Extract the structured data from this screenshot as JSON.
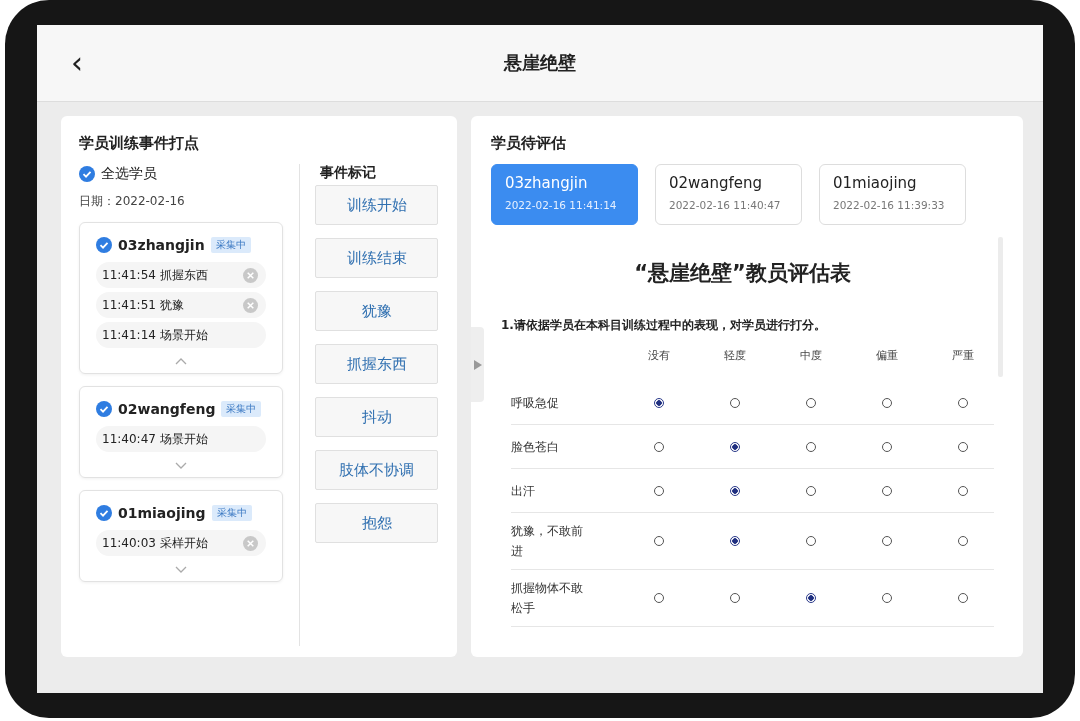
{
  "header": {
    "back_icon": "‹",
    "title": "悬崖绝壁"
  },
  "event_panel": {
    "title": "学员训练事件打点",
    "select_all": {
      "label": "全选学员",
      "checked": true
    },
    "date": "日期：2022-02-16",
    "students": [
      {
        "name": "03zhangjin",
        "checked": true,
        "status": "采集中",
        "expanded": true,
        "events": [
          {
            "text": "11:41:54 抓握东西",
            "removable": true
          },
          {
            "text": "11:41:51 犹豫",
            "removable": true
          },
          {
            "text": "11:41:14 场景开始",
            "removable": false
          }
        ]
      },
      {
        "name": "02wangfeng",
        "checked": true,
        "status": "采集中",
        "expanded": false,
        "events": [
          {
            "text": "11:40:47 场景开始",
            "removable": false
          }
        ]
      },
      {
        "name": "01miaojing",
        "checked": true,
        "status": "采集中",
        "expanded": false,
        "events": [
          {
            "text": "11:40:03 采样开始",
            "removable": true
          }
        ]
      }
    ],
    "markers_title": "事件标记",
    "markers": [
      "训练开始",
      "训练结束",
      "犹豫",
      "抓握东西",
      "抖动",
      "肢体不协调",
      "抱怨"
    ]
  },
  "evaluation_panel": {
    "title": "学员待评估",
    "tabs": [
      {
        "name": "03zhangjin",
        "time": "2022-02-16 11:41:14",
        "selected": true
      },
      {
        "name": "02wangfeng",
        "time": "2022-02-16 11:40:47",
        "selected": false
      },
      {
        "name": "01miaojing",
        "time": "2022-02-16 11:39:33",
        "selected": false
      }
    ],
    "form": {
      "title": "“悬崖绝壁”教员评估表",
      "question": "1.请依据学员在本科目训练过程中的表现，对学员进行打分。",
      "columns": [
        "没有",
        "轻度",
        "中度",
        "偏重",
        "严重"
      ],
      "rows": [
        {
          "label": "呼吸急促",
          "choices": [
            {
              "selected": true
            },
            {
              "selected": false
            },
            {
              "selected": false
            },
            {
              "selected": false
            },
            {
              "selected": false
            }
          ]
        },
        {
          "label": "脸色苍白",
          "choices": [
            {
              "selected": false
            },
            {
              "selected": true
            },
            {
              "selected": false
            },
            {
              "selected": false
            },
            {
              "selected": false
            }
          ]
        },
        {
          "label": "出汗",
          "choices": [
            {
              "selected": false
            },
            {
              "selected": true
            },
            {
              "selected": false
            },
            {
              "selected": false
            },
            {
              "selected": false
            }
          ]
        },
        {
          "label": "犹豫，不敢前进",
          "choices": [
            {
              "selected": false
            },
            {
              "selected": true
            },
            {
              "selected": false
            },
            {
              "selected": false
            },
            {
              "selected": false
            }
          ]
        },
        {
          "label": "抓握物体不敢松手",
          "choices": [
            {
              "selected": false
            },
            {
              "selected": false
            },
            {
              "selected": true
            },
            {
              "selected": false
            },
            {
              "selected": false
            }
          ]
        }
      ]
    }
  }
}
